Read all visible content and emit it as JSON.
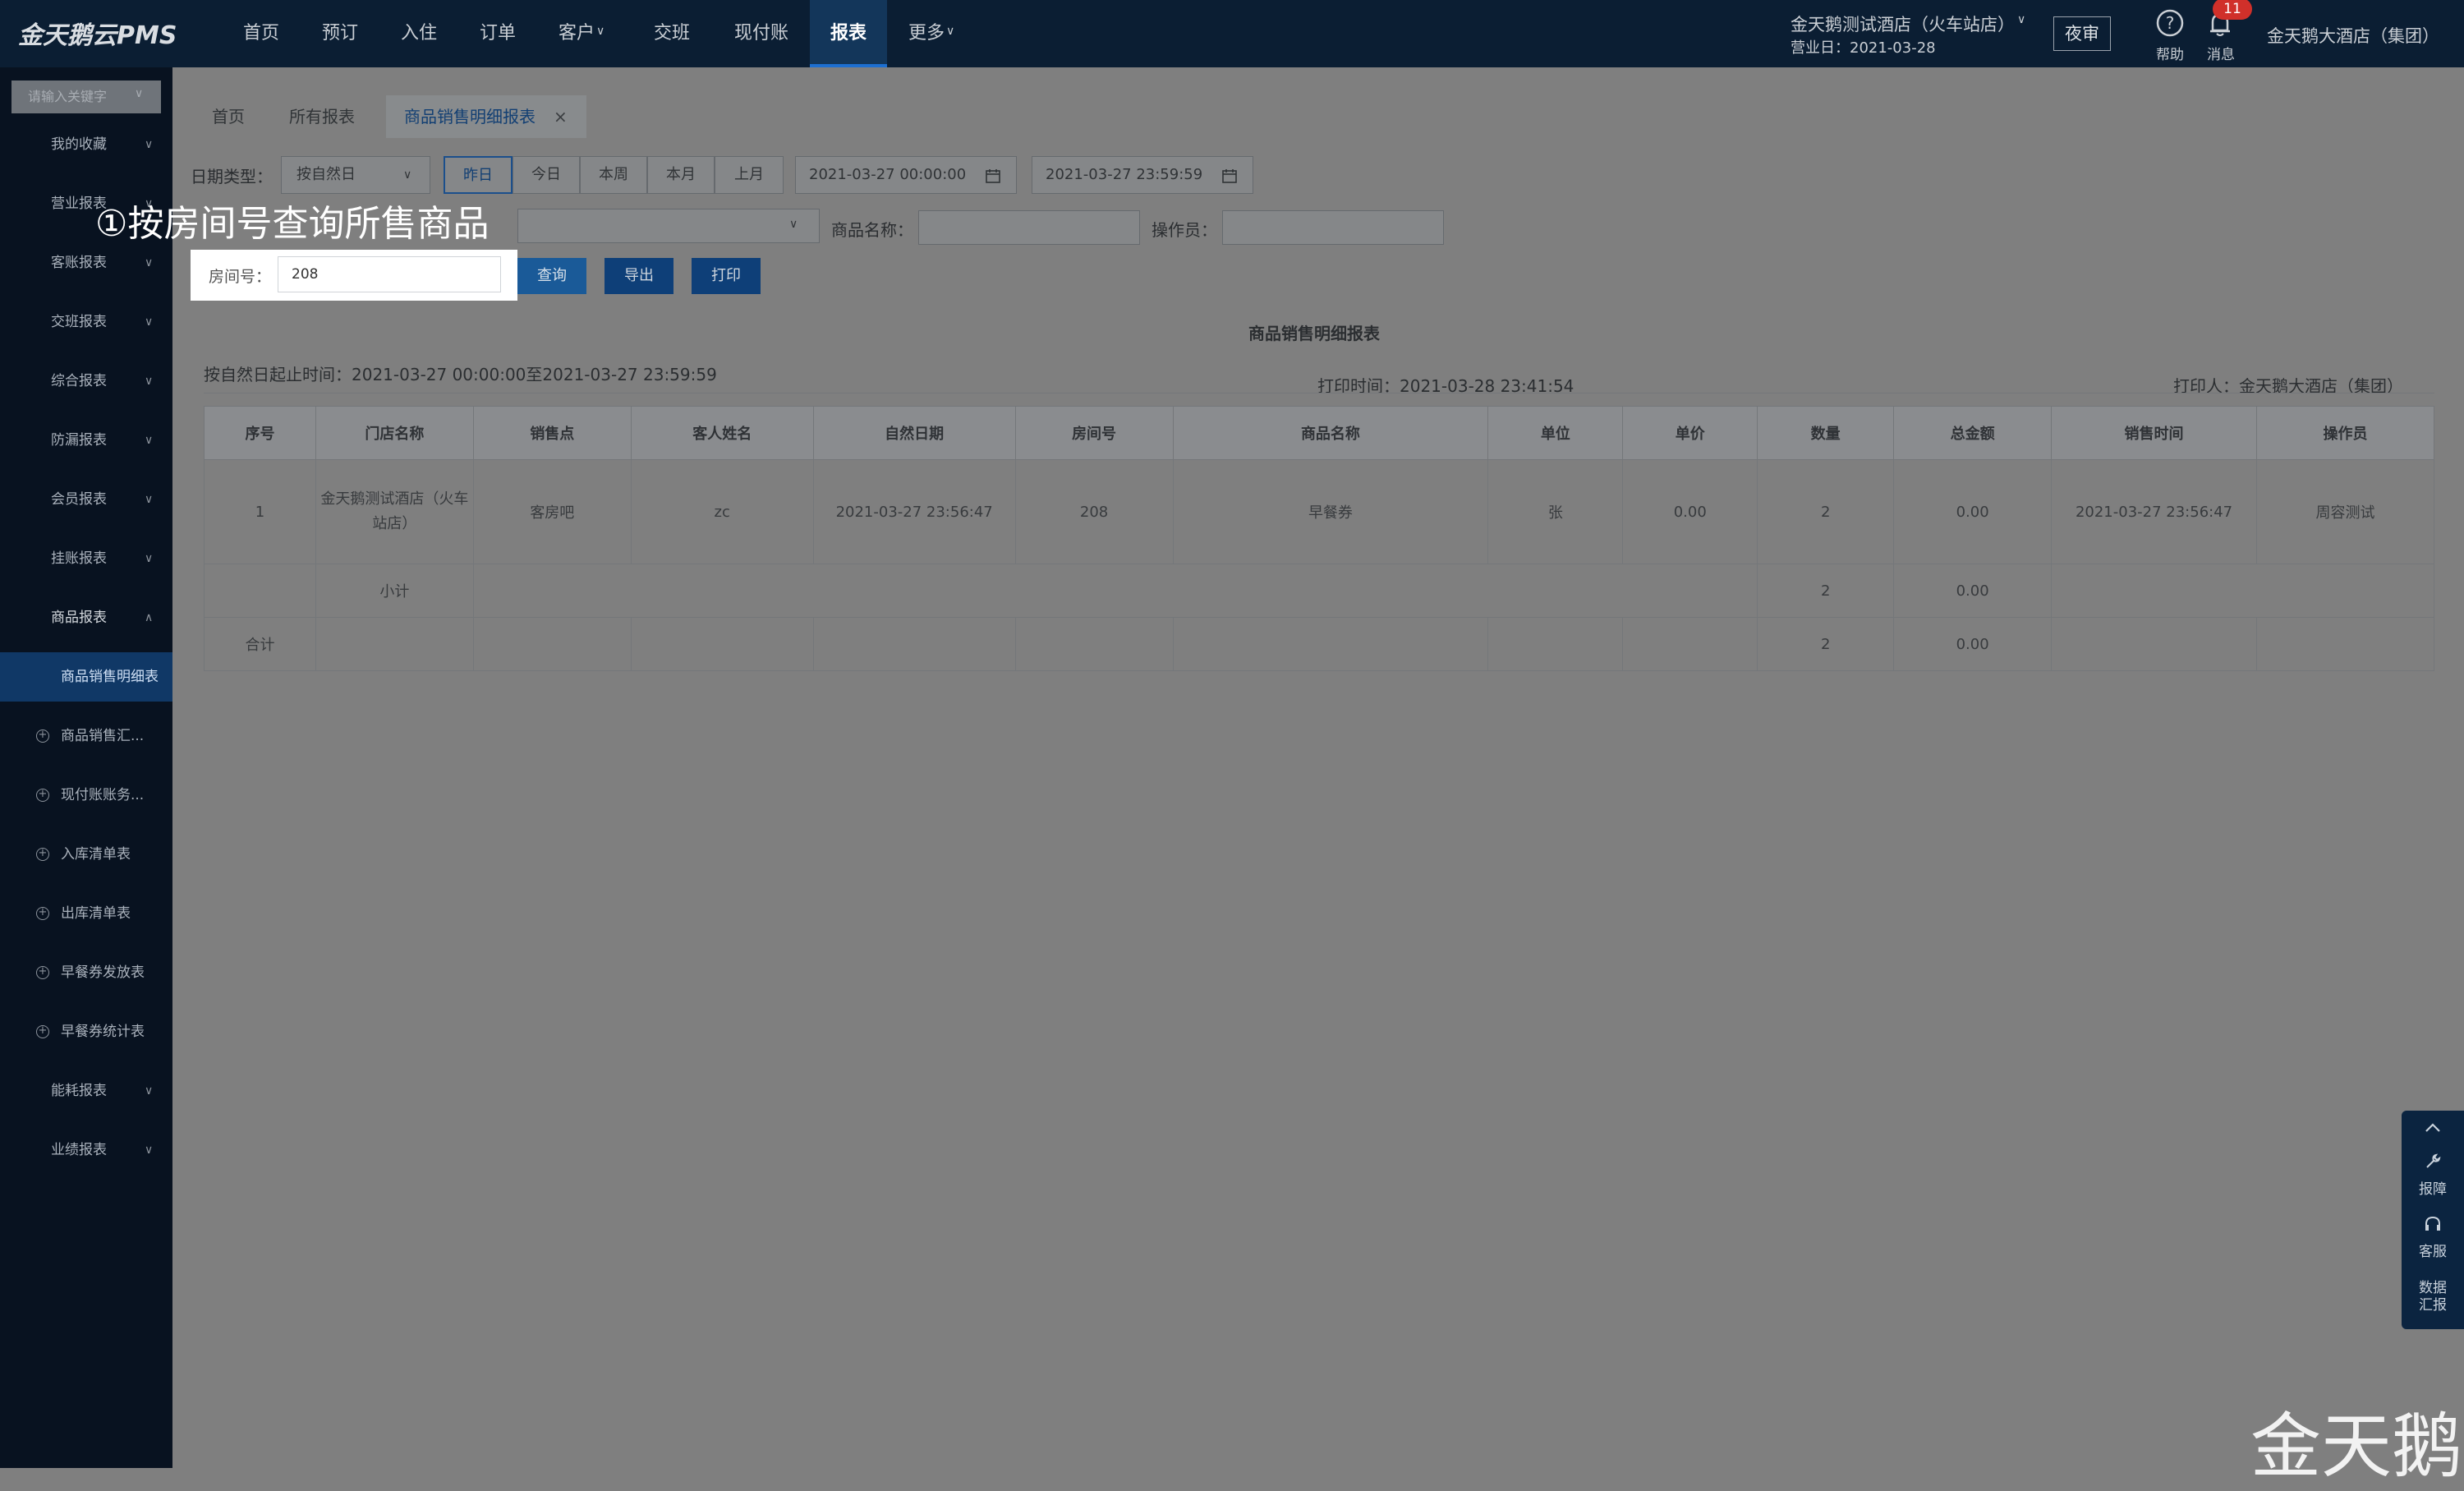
{
  "app": {
    "logo": "金天鹅云PMS"
  },
  "nav": [
    "首页",
    "预订",
    "入住",
    "订单",
    "客户",
    "交班",
    "现付账",
    "报表",
    "更多"
  ],
  "nav_active": "报表",
  "header": {
    "hotel": "金天鹅测试酒店（火车站店）",
    "business_date": "营业日：2021-03-28",
    "audit_button": "夜审",
    "help": "帮助",
    "messages": "消息",
    "message_count": "11",
    "user": "金天鹅大酒店（集团）"
  },
  "sidebar": {
    "search_placeholder": "请输入关键字",
    "items": [
      "我的收藏",
      "营业报表",
      "客账报表",
      "交班报表",
      "综合报表",
      "防漏报表",
      "会员报表",
      "挂账报表",
      "商品报表"
    ],
    "sub_selected": "商品销售明细表",
    "sub_items": [
      "商品销售汇...",
      "现付账账务...",
      "入库清单表",
      "出库清单表",
      "早餐券发放表",
      "早餐券统计表"
    ],
    "items_after": [
      "能耗报表",
      "业绩报表"
    ]
  },
  "tabs": [
    "首页",
    "所有报表",
    "商品销售明细报表"
  ],
  "filters": {
    "date_type_label": "日期类型：",
    "date_type_value": "按自然日",
    "quick_dates": [
      "昨日",
      "今日",
      "本周",
      "本月",
      "上月"
    ],
    "start": "2021-03-27 00:00:00",
    "end": "2021-03-27 23:59:59",
    "product_name_label": "商品名称：",
    "operator_label": "操作员：",
    "room_label": "房间号：",
    "room_value": "208"
  },
  "buttons": {
    "query": "查询",
    "export": "导出",
    "print": "打印"
  },
  "callout": "①按房间号查询所售商品",
  "report": {
    "title": "商品销售明细报表",
    "range": "按自然日起止时间：2021-03-27 00:00:00至2021-03-27 23:59:59",
    "print_time": "打印时间：2021-03-28 23:41:54",
    "printer": "打印人：金天鹅大酒店（集团）"
  },
  "table": {
    "columns": [
      "序号",
      "门店名称",
      "销售点",
      "客人姓名",
      "自然日期",
      "房间号",
      "商品名称",
      "单位",
      "单价",
      "数量",
      "总金额",
      "销售时间",
      "操作员"
    ],
    "row": [
      "1",
      "金天鹅测试酒店（火车站店）",
      "客房吧",
      "zc",
      "2021-03-27 23:56:47",
      "208",
      "早餐券",
      "张",
      "0.00",
      "2",
      "0.00",
      "2021-03-27 23:56:47",
      "周容测试"
    ],
    "subtotal": {
      "label": "小计",
      "qty": "2",
      "amount": "0.00"
    },
    "total": {
      "label": "合计",
      "qty": "2",
      "amount": "0.00"
    }
  },
  "float_panel": {
    "report_issue": "报障",
    "service": "客服",
    "data_report": "数据\n汇报"
  },
  "watermark": "金天鹅"
}
